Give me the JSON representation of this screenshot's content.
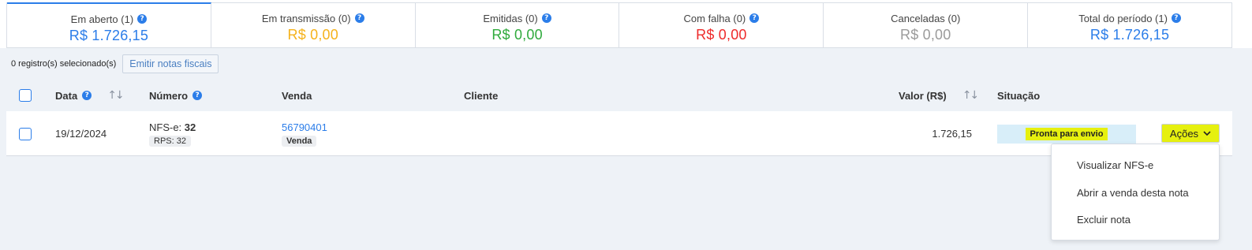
{
  "tabs": [
    {
      "label": "Em aberto (1)",
      "value": "R$ 1.726,15",
      "color": "#2b7de9",
      "help": true,
      "active": true
    },
    {
      "label": "Em transmissão (0)",
      "value": "R$ 0,00",
      "color": "#f5b21b",
      "help": true,
      "active": false
    },
    {
      "label": "Emitidas (0)",
      "value": "R$ 0,00",
      "color": "#2faa3c",
      "help": true,
      "active": false
    },
    {
      "label": "Com falha (0)",
      "value": "R$ 0,00",
      "color": "#ee2b2b",
      "help": true,
      "active": false
    },
    {
      "label": "Canceladas (0)",
      "value": "R$ 0,00",
      "color": "#9b9b9b",
      "help": false,
      "active": false
    },
    {
      "label": "Total do período (1)",
      "value": "R$ 1.726,15",
      "color": "#2b7de9",
      "help": true,
      "active": false
    }
  ],
  "selection": {
    "text": "0 registro(s) selecionado(s)",
    "emit_button": "Emitir notas fiscais"
  },
  "table": {
    "headers": {
      "data": "Data",
      "numero": "Número",
      "venda": "Venda",
      "cliente": "Cliente",
      "valor": "Valor (R$)",
      "situacao": "Situação"
    },
    "row": {
      "data": "19/12/2024",
      "numero_prefix": "NFS-e:",
      "numero": "32",
      "rps": "RPS: 32",
      "venda_link": "56790401",
      "venda_tag": "Venda",
      "cliente": "",
      "valor": "1.726,15",
      "situacao": "Pronta para envio",
      "acoes": "Ações"
    }
  },
  "menu": [
    "Visualizar NFS-e",
    "Abrir a venda desta nota",
    "Excluir nota"
  ],
  "icons": {
    "help": "question-circle-icon",
    "sort": "sort-arrows-icon",
    "chevron": "chevron-down-icon"
  },
  "colors": {
    "accent": "#2b7de9",
    "highlight": "#e6f00f",
    "status_bg": "#d8eef9",
    "page_bg": "#eef2f7"
  }
}
